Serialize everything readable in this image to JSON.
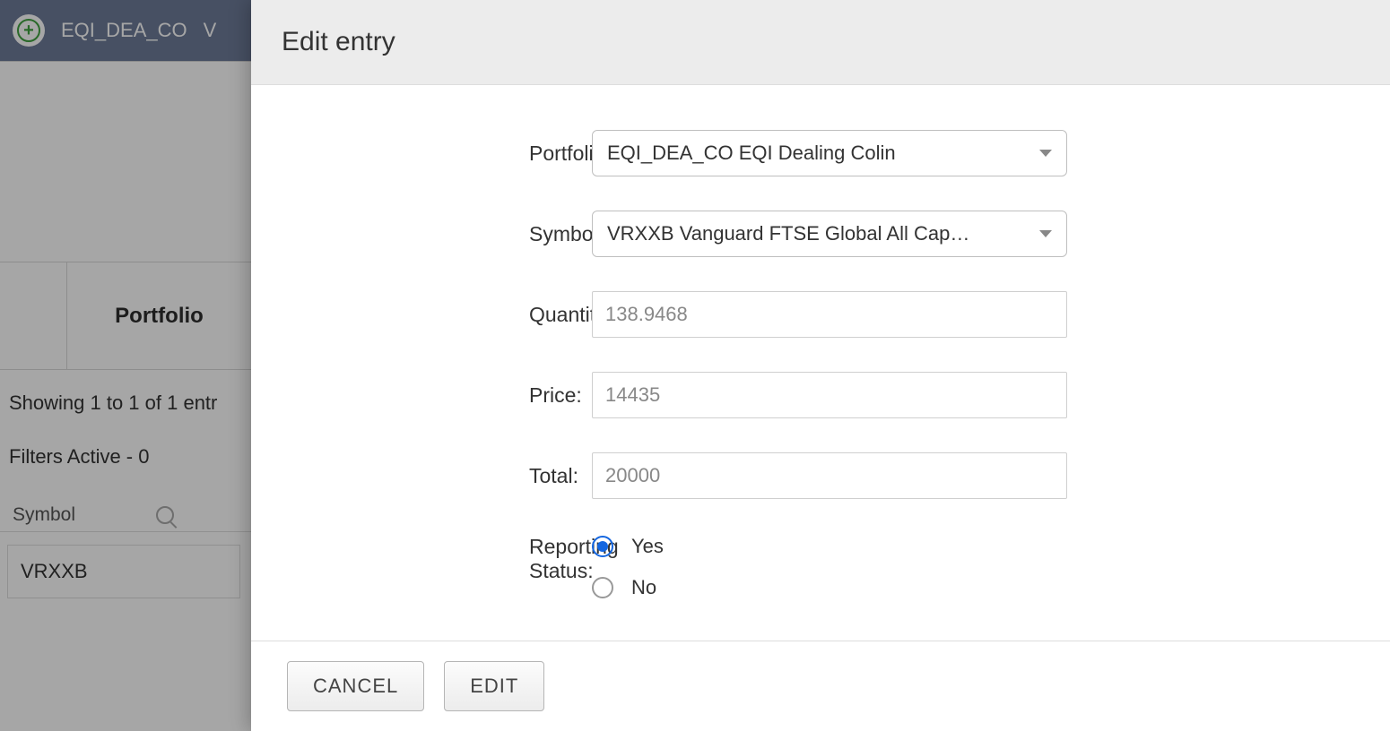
{
  "background": {
    "toolbar_label": "EQI_DEA_CO",
    "toolbar_tail": "V",
    "header_portfolio": "Portfolio",
    "status_text": "Showing 1 to 1 of 1 entr",
    "filters_text": "Filters Active - 0",
    "symbol_header": "Symbol",
    "symbol_value": "VRXXB"
  },
  "modal": {
    "title": "Edit entry",
    "labels": {
      "portfolio": "Portfolio:",
      "symbol": "Symbol:",
      "quantity": "Quantity:",
      "price": "Price:",
      "total": "Total:",
      "reporting": "Reporting Status:"
    },
    "values": {
      "portfolio": "EQI_DEA_CO EQI Dealing Colin",
      "symbol": "VRXXB Vanguard FTSE Global All Cap…",
      "quantity": "138.9468",
      "price": "14435",
      "total": "20000"
    },
    "reporting": {
      "yes": "Yes",
      "no": "No",
      "selected": "yes"
    },
    "buttons": {
      "cancel": "CANCEL",
      "edit": "EDIT"
    }
  }
}
